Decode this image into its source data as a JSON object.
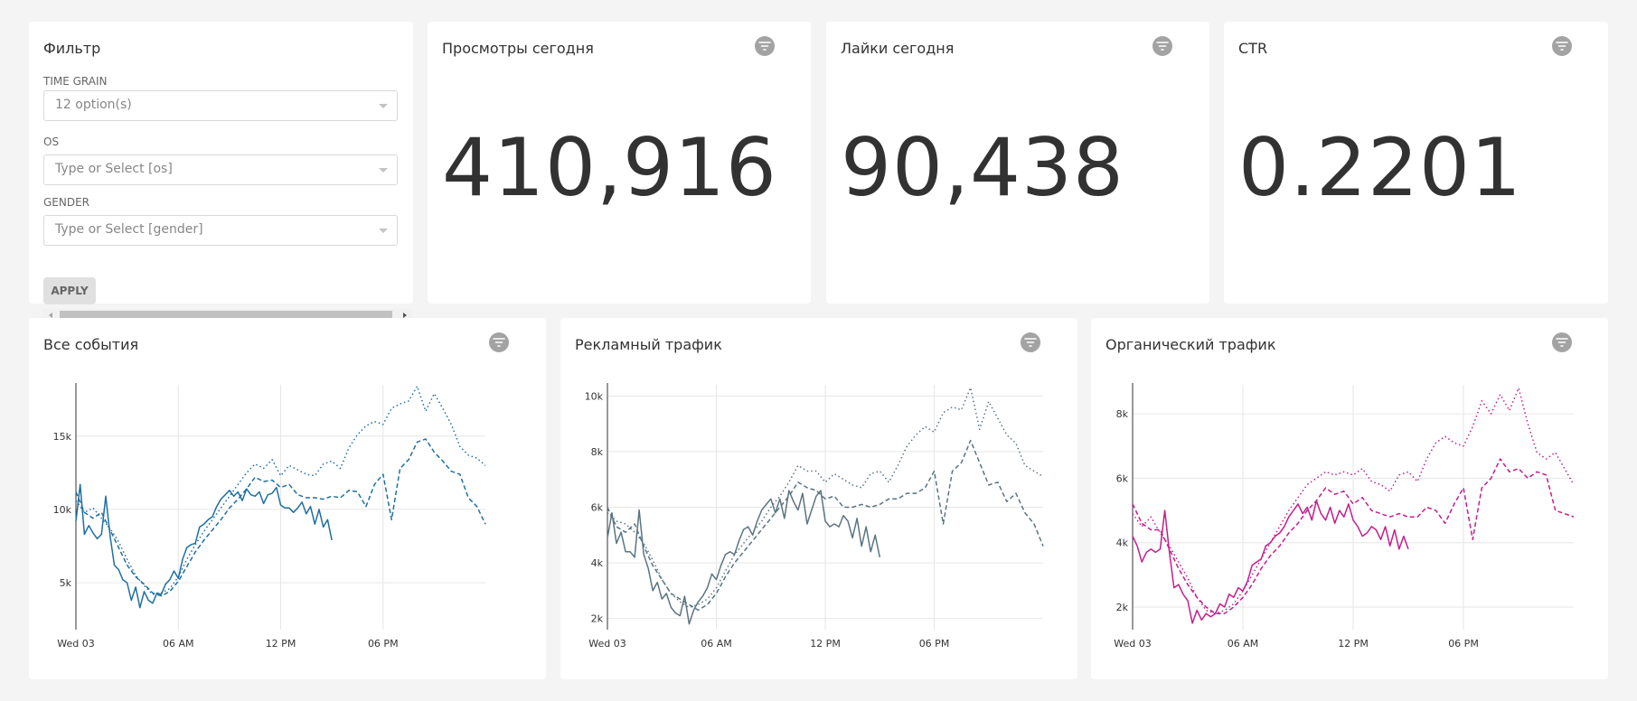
{
  "filter": {
    "title": "Фильтр",
    "time_grain_label": "TIME GRAIN",
    "time_grain_value": "12 option(s)",
    "os_label": "OS",
    "os_placeholder": "Type or Select [os]",
    "gender_label": "GENDER",
    "gender_placeholder": "Type or Select [gender]",
    "apply_label": "APPLY"
  },
  "kpis": [
    {
      "title": "Просмотры сегодня",
      "value": "410,916"
    },
    {
      "title": "Лайки сегодня",
      "value": "90,438"
    },
    {
      "title": "CTR",
      "value": "0.2201"
    }
  ],
  "chart_data": [
    {
      "type": "line",
      "title": "Все события",
      "color": "#1f6fa3",
      "x_ticks": [
        "Wed 03",
        "06 AM",
        "12 PM",
        "06 PM"
      ],
      "y_ticks": [
        5000,
        10000,
        15000
      ],
      "y_tick_labels": [
        "5k",
        "10k",
        "15k"
      ],
      "ylim": [
        1800,
        18500
      ],
      "x_range_hours": [
        0,
        24
      ],
      "series": [
        {
          "style": "solid",
          "x": [
            0,
            0.25,
            0.5,
            0.75,
            1,
            1.25,
            1.5,
            1.75,
            2,
            2.25,
            2.5,
            2.75,
            3,
            3.25,
            3.5,
            3.75,
            4,
            4.25,
            4.5,
            4.75,
            5,
            5.25,
            5.5,
            5.75,
            6,
            6.25,
            6.5,
            6.75,
            7,
            7.25,
            7.5,
            7.75,
            8,
            8.25,
            8.5,
            8.75,
            9,
            9.25,
            9.5,
            9.75,
            10,
            10.25,
            10.5,
            10.75,
            11,
            11.25,
            11.5,
            11.75,
            12,
            12.25,
            12.5,
            12.75,
            13,
            13.25,
            13.5,
            13.75,
            14,
            14.25,
            14.5,
            14.75,
            15
          ],
          "y": [
            9200,
            11700,
            8300,
            8900,
            8400,
            8000,
            8300,
            10900,
            8200,
            6200,
            5900,
            5200,
            5000,
            3800,
            4700,
            3300,
            4400,
            3800,
            3600,
            4300,
            4200,
            4900,
            5200,
            5800,
            5300,
            6600,
            7400,
            7600,
            7700,
            8800,
            9000,
            9300,
            9500,
            10200,
            10700,
            11000,
            11300,
            10900,
            11200,
            10600,
            11400,
            11000,
            10900,
            11200,
            10400,
            11000,
            11100,
            11500,
            10300,
            10100,
            10100,
            9800,
            10100,
            10500,
            9700,
            10200,
            9000,
            10000,
            8800,
            9300,
            7900
          ]
        },
        {
          "style": "dashed",
          "x": [
            0,
            0.5,
            1,
            1.5,
            2,
            2.5,
            3,
            3.5,
            4,
            4.5,
            5,
            5.5,
            6,
            6.5,
            7,
            7.5,
            8,
            8.5,
            9,
            9.5,
            10,
            10.5,
            11,
            11.5,
            12,
            12.5,
            13,
            13.5,
            14,
            14.5,
            15,
            15.5,
            16,
            16.5,
            17,
            17.5,
            18,
            18.5,
            19,
            19.5,
            20,
            20.5,
            21,
            21.5,
            22,
            22.5,
            23,
            23.5,
            24
          ],
          "y": [
            11200,
            9800,
            9400,
            9800,
            8600,
            7400,
            6200,
            5400,
            4900,
            4300,
            4100,
            4400,
            5100,
            6100,
            7100,
            7900,
            8600,
            9300,
            10100,
            10700,
            11400,
            12200,
            11900,
            12000,
            11500,
            11700,
            11000,
            10800,
            10800,
            10700,
            10900,
            10800,
            11300,
            11200,
            10200,
            11700,
            12400,
            9300,
            12800,
            13400,
            14600,
            14800,
            13900,
            13300,
            12600,
            12400,
            10800,
            10200,
            9000
          ]
        },
        {
          "style": "dotted",
          "x": [
            0,
            0.5,
            1,
            1.5,
            2,
            2.5,
            3,
            3.5,
            4,
            4.5,
            5,
            5.5,
            6,
            6.5,
            7,
            7.5,
            8,
            8.5,
            9,
            9.5,
            10,
            10.5,
            11,
            11.5,
            12,
            12.5,
            13,
            13.5,
            14,
            14.5,
            15,
            15.5,
            16,
            16.5,
            17,
            17.5,
            18,
            18.5,
            19,
            19.5,
            20,
            20.5,
            21,
            21.5,
            22,
            22.5,
            23,
            23.5,
            24
          ],
          "y": [
            10600,
            9800,
            10100,
            9400,
            8700,
            7800,
            6600,
            5500,
            4800,
            4200,
            4300,
            4600,
            5400,
            6600,
            7600,
            8500,
            9300,
            10100,
            10900,
            11700,
            12500,
            13100,
            12800,
            13400,
            12300,
            13000,
            12700,
            12400,
            12300,
            13100,
            13300,
            12800,
            14200,
            15100,
            15700,
            16000,
            15800,
            16900,
            17200,
            17400,
            18400,
            16700,
            17900,
            16900,
            15800,
            14300,
            13700,
            13500,
            13000
          ]
        }
      ]
    },
    {
      "type": "line",
      "title": "Рекламный трафик",
      "color": "#5a7582",
      "x_ticks": [
        "Wed 03",
        "06 AM",
        "12 PM",
        "06 PM"
      ],
      "y_ticks": [
        2000,
        4000,
        6000,
        8000,
        10000
      ],
      "y_tick_labels": [
        "2k",
        "4k",
        "6k",
        "8k",
        "10k"
      ],
      "ylim": [
        1600,
        10400
      ],
      "x_range_hours": [
        0,
        24
      ],
      "series": [
        {
          "style": "solid",
          "x": [
            0,
            0.25,
            0.5,
            0.75,
            1,
            1.25,
            1.5,
            1.75,
            2,
            2.25,
            2.5,
            2.75,
            3,
            3.25,
            3.5,
            3.75,
            4,
            4.25,
            4.5,
            4.75,
            5,
            5.25,
            5.5,
            5.75,
            6,
            6.25,
            6.5,
            6.75,
            7,
            7.25,
            7.5,
            7.75,
            8,
            8.25,
            8.5,
            8.75,
            9,
            9.25,
            9.5,
            9.75,
            10,
            10.25,
            10.5,
            10.75,
            11,
            11.25,
            11.5,
            11.75,
            12,
            12.25,
            12.5,
            12.75,
            13,
            13.25,
            13.5,
            13.75,
            14,
            14.25,
            14.5,
            14.75,
            15
          ],
          "y": [
            4900,
            5800,
            4700,
            5100,
            4400,
            4400,
            4200,
            5900,
            4300,
            3800,
            3000,
            3300,
            2700,
            2900,
            2400,
            2200,
            2100,
            2800,
            1800,
            2300,
            2600,
            2800,
            3100,
            3600,
            3400,
            3900,
            4300,
            4400,
            4300,
            4800,
            5200,
            5300,
            5000,
            5500,
            5900,
            6100,
            6300,
            5800,
            6300,
            5600,
            6600,
            6200,
            5900,
            6500,
            5400,
            5900,
            6400,
            6600,
            5500,
            5300,
            5400,
            5300,
            5700,
            5500,
            4900,
            5600,
            4600,
            5300,
            4400,
            5000,
            4200
          ]
        },
        {
          "style": "dashed",
          "x": [
            0,
            0.5,
            1,
            1.5,
            2,
            2.5,
            3,
            3.5,
            4,
            4.5,
            5,
            5.5,
            6,
            6.5,
            7,
            7.5,
            8,
            8.5,
            9,
            9.5,
            10,
            10.5,
            11,
            11.5,
            12,
            12.5,
            13,
            13.5,
            14,
            14.5,
            15,
            15.5,
            16,
            16.5,
            17,
            17.5,
            18,
            18.5,
            19,
            19.5,
            20,
            20.5,
            21,
            21.5,
            22,
            22.5,
            23,
            23.5,
            24
          ],
          "y": [
            6000,
            5300,
            5100,
            5400,
            4600,
            3900,
            3400,
            2900,
            2700,
            2500,
            2300,
            2500,
            2900,
            3500,
            4000,
            4400,
            4800,
            5200,
            5600,
            6000,
            6400,
            6900,
            6700,
            6600,
            6300,
            6400,
            6000,
            6000,
            6100,
            6000,
            6100,
            6300,
            6300,
            6500,
            6500,
            6700,
            7300,
            5400,
            7300,
            7600,
            8400,
            7600,
            6800,
            6900,
            6200,
            6500,
            5800,
            5400,
            4600
          ]
        },
        {
          "style": "dotted",
          "x": [
            0,
            0.5,
            1,
            1.5,
            2,
            2.5,
            3,
            3.5,
            4,
            4.5,
            5,
            5.5,
            6,
            6.5,
            7,
            7.5,
            8,
            8.5,
            9,
            9.5,
            10,
            10.5,
            11,
            11.5,
            12,
            12.5,
            13,
            13.5,
            14,
            14.5,
            15,
            15.5,
            16,
            16.5,
            17,
            17.5,
            18,
            18.5,
            19,
            19.5,
            20,
            20.5,
            21,
            21.5,
            22,
            22.5,
            23,
            23.5,
            24
          ],
          "y": [
            5800,
            5500,
            5400,
            5100,
            4700,
            4100,
            3400,
            2900,
            2600,
            2400,
            2500,
            2700,
            3100,
            3700,
            4300,
            4700,
            5100,
            5500,
            6000,
            6400,
            6900,
            7500,
            7300,
            7300,
            6900,
            7200,
            7000,
            6800,
            6700,
            7200,
            7300,
            6900,
            7500,
            8200,
            8600,
            8900,
            8700,
            9400,
            9600,
            9500,
            10300,
            8800,
            9800,
            9200,
            8600,
            8300,
            7500,
            7300,
            7100
          ]
        }
      ]
    },
    {
      "type": "line",
      "title": "Органический трафик",
      "color": "#c41e8c",
      "x_ticks": [
        "Wed 03",
        "06 AM",
        "12 PM",
        "06 PM"
      ],
      "y_ticks": [
        2000,
        4000,
        6000,
        8000
      ],
      "y_tick_labels": [
        "2k",
        "4k",
        "6k",
        "8k"
      ],
      "ylim": [
        1300,
        8900
      ],
      "x_range_hours": [
        0,
        24
      ],
      "series": [
        {
          "style": "solid",
          "x": [
            0,
            0.25,
            0.5,
            0.75,
            1,
            1.25,
            1.5,
            1.75,
            2,
            2.25,
            2.5,
            2.75,
            3,
            3.25,
            3.5,
            3.75,
            4,
            4.25,
            4.5,
            4.75,
            5,
            5.25,
            5.5,
            5.75,
            6,
            6.25,
            6.5,
            6.75,
            7,
            7.25,
            7.5,
            7.75,
            8,
            8.25,
            8.5,
            8.75,
            9,
            9.25,
            9.5,
            9.75,
            10,
            10.25,
            10.5,
            10.75,
            11,
            11.25,
            11.5,
            11.75,
            12,
            12.25,
            12.5,
            12.75,
            13,
            13.25,
            13.5,
            13.75,
            14,
            14.25,
            14.5,
            14.75,
            15
          ],
          "y": [
            4200,
            3900,
            3400,
            3700,
            3800,
            3700,
            3800,
            5000,
            3700,
            2600,
            2700,
            2400,
            2200,
            1500,
            1900,
            1600,
            1800,
            1700,
            1800,
            2100,
            2000,
            2400,
            2300,
            2600,
            2500,
            2800,
            3300,
            3400,
            3500,
            3900,
            4000,
            4200,
            4300,
            4500,
            4800,
            5000,
            5200,
            4900,
            5100,
            4700,
            5300,
            4900,
            4700,
            5100,
            4600,
            5000,
            4800,
            5200,
            4700,
            4500,
            4200,
            4300,
            4500,
            4400,
            4100,
            4500,
            3900,
            4400,
            3800,
            4200,
            3800
          ]
        },
        {
          "style": "dashed",
          "x": [
            0,
            0.5,
            1,
            1.5,
            2,
            2.5,
            3,
            3.5,
            4,
            4.5,
            5,
            5.5,
            6,
            6.5,
            7,
            7.5,
            8,
            8.5,
            9,
            9.5,
            10,
            10.5,
            11,
            11.5,
            12,
            12.5,
            13,
            13.5,
            14,
            14.5,
            15,
            15.5,
            16,
            16.5,
            17,
            17.5,
            18,
            18.5,
            19,
            19.5,
            20,
            20.5,
            21,
            21.5,
            22,
            22.5,
            23,
            23.5,
            24
          ],
          "y": [
            5200,
            4600,
            4400,
            4400,
            3800,
            3200,
            2700,
            2300,
            2000,
            1800,
            1800,
            2000,
            2300,
            2700,
            3200,
            3600,
            3900,
            4300,
            4600,
            5000,
            5300,
            5700,
            5500,
            5600,
            5200,
            5400,
            5000,
            4900,
            4800,
            4900,
            4800,
            4800,
            5100,
            5000,
            4600,
            5200,
            5700,
            4100,
            5700,
            6000,
            6600,
            6200,
            6300,
            6000,
            6200,
            6100,
            5000,
            4900,
            4800
          ]
        },
        {
          "style": "dotted",
          "x": [
            0,
            0.5,
            1,
            1.5,
            2,
            2.5,
            3,
            3.5,
            4,
            4.5,
            5,
            5.5,
            6,
            6.5,
            7,
            7.5,
            8,
            8.5,
            9,
            9.5,
            10,
            10.5,
            11,
            11.5,
            12,
            12.5,
            13,
            13.5,
            14,
            14.5,
            15,
            15.5,
            16,
            16.5,
            17,
            17.5,
            18,
            18.5,
            19,
            19.5,
            20,
            20.5,
            21,
            21.5,
            22,
            22.5,
            23,
            23.5,
            24
          ],
          "y": [
            4900,
            4500,
            4800,
            4300,
            3900,
            3400,
            2900,
            2300,
            1900,
            1800,
            1900,
            2100,
            2500,
            3000,
            3500,
            4000,
            4500,
            5000,
            5400,
            5800,
            6000,
            6200,
            6100,
            6200,
            6100,
            6300,
            5900,
            5800,
            5600,
            6100,
            6200,
            5900,
            6600,
            7100,
            7300,
            7100,
            7000,
            7600,
            8400,
            8000,
            8600,
            8100,
            8800,
            7700,
            6800,
            6600,
            6800,
            6300,
            5800
          ]
        }
      ]
    }
  ]
}
